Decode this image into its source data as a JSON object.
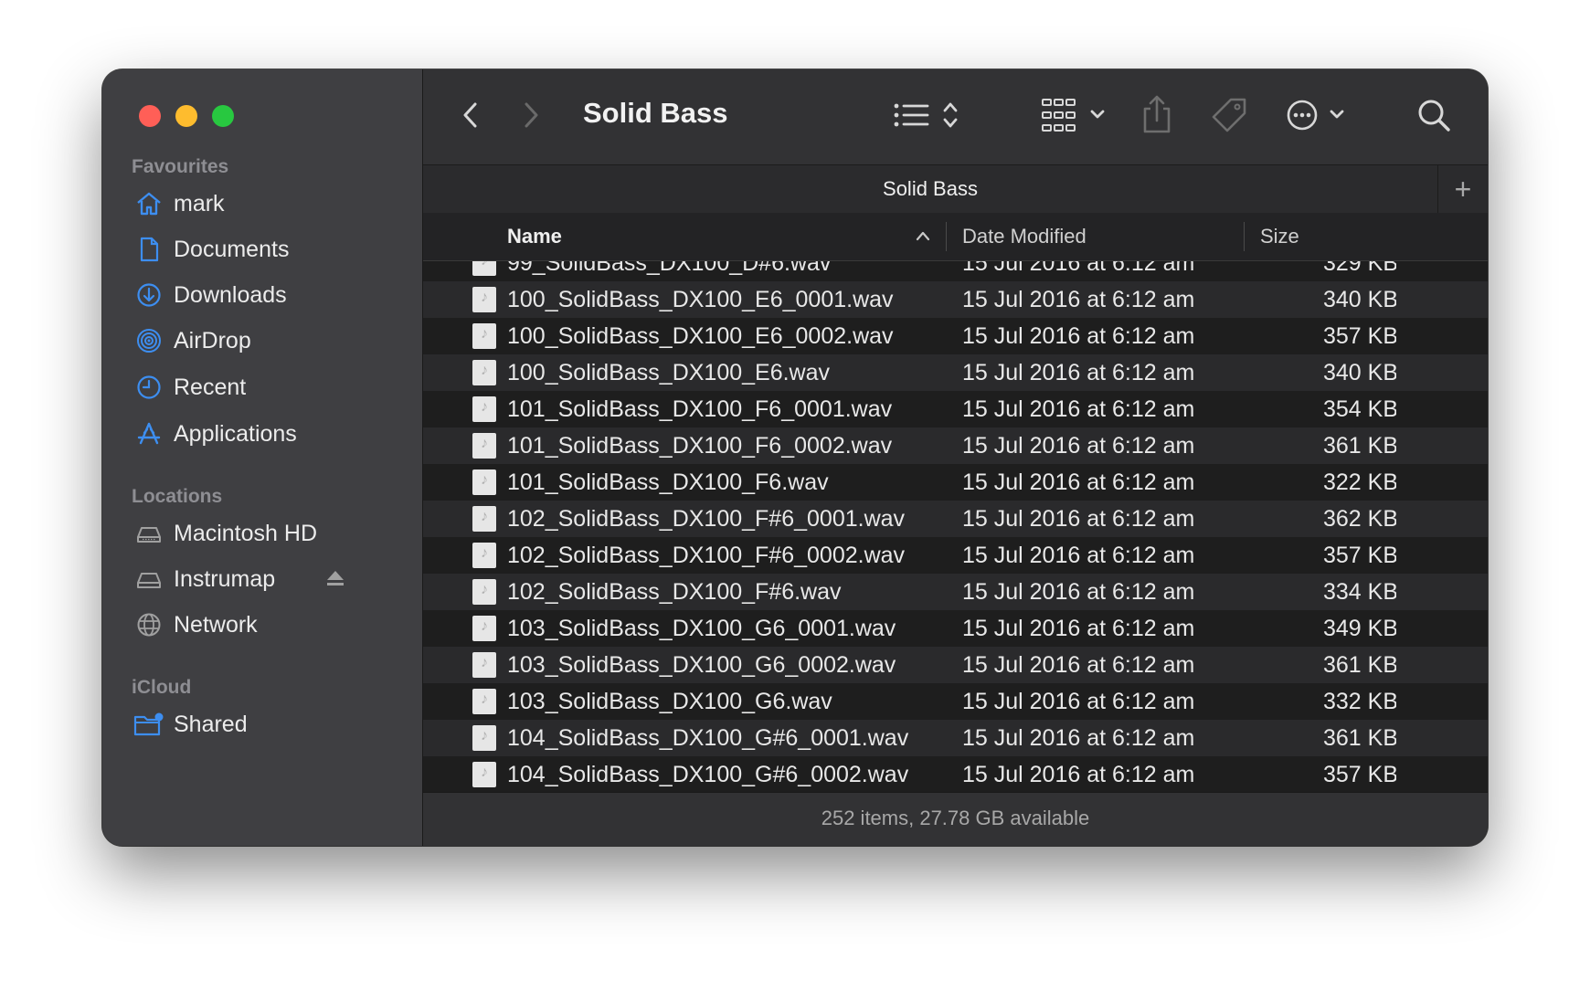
{
  "window": {
    "title": "Solid Bass"
  },
  "sidebar": {
    "favourites_label": "Favourites",
    "favourites": [
      {
        "label": "mark",
        "icon": "home-icon"
      },
      {
        "label": "Documents",
        "icon": "document-icon"
      },
      {
        "label": "Downloads",
        "icon": "download-icon"
      },
      {
        "label": "AirDrop",
        "icon": "airdrop-icon"
      },
      {
        "label": "Recent",
        "icon": "clock-icon"
      },
      {
        "label": "Applications",
        "icon": "applications-icon"
      }
    ],
    "locations_label": "Locations",
    "locations": [
      {
        "label": "Macintosh HD",
        "icon": "drive-icon"
      },
      {
        "label": "Instrumap",
        "icon": "drive-icon"
      },
      {
        "label": "Network",
        "icon": "globe-icon"
      }
    ],
    "icloud_label": "iCloud",
    "icloud": [
      {
        "label": "Shared",
        "icon": "shared-folder-icon"
      }
    ]
  },
  "tab": {
    "title": "Solid Bass",
    "add": "+"
  },
  "columns": {
    "name": "Name",
    "date": "Date Modified",
    "size": "Size"
  },
  "files": [
    {
      "name": "99_SolidBass_DX100_D#6.wav",
      "date": "15 Jul 2016 at 6:12 am",
      "size": "329 KB"
    },
    {
      "name": "100_SolidBass_DX100_E6_0001.wav",
      "date": "15 Jul 2016 at 6:12 am",
      "size": "340 KB"
    },
    {
      "name": "100_SolidBass_DX100_E6_0002.wav",
      "date": "15 Jul 2016 at 6:12 am",
      "size": "357 KB"
    },
    {
      "name": "100_SolidBass_DX100_E6.wav",
      "date": "15 Jul 2016 at 6:12 am",
      "size": "340 KB"
    },
    {
      "name": "101_SolidBass_DX100_F6_0001.wav",
      "date": "15 Jul 2016 at 6:12 am",
      "size": "354 KB"
    },
    {
      "name": "101_SolidBass_DX100_F6_0002.wav",
      "date": "15 Jul 2016 at 6:12 am",
      "size": "361 KB"
    },
    {
      "name": "101_SolidBass_DX100_F6.wav",
      "date": "15 Jul 2016 at 6:12 am",
      "size": "322 KB"
    },
    {
      "name": "102_SolidBass_DX100_F#6_0001.wav",
      "date": "15 Jul 2016 at 6:12 am",
      "size": "362 KB"
    },
    {
      "name": "102_SolidBass_DX100_F#6_0002.wav",
      "date": "15 Jul 2016 at 6:12 am",
      "size": "357 KB"
    },
    {
      "name": "102_SolidBass_DX100_F#6.wav",
      "date": "15 Jul 2016 at 6:12 am",
      "size": "334 KB"
    },
    {
      "name": "103_SolidBass_DX100_G6_0001.wav",
      "date": "15 Jul 2016 at 6:12 am",
      "size": "349 KB"
    },
    {
      "name": "103_SolidBass_DX100_G6_0002.wav",
      "date": "15 Jul 2016 at 6:12 am",
      "size": "361 KB"
    },
    {
      "name": "103_SolidBass_DX100_G6.wav",
      "date": "15 Jul 2016 at 6:12 am",
      "size": "332 KB"
    },
    {
      "name": "104_SolidBass_DX100_G#6_0001.wav",
      "date": "15 Jul 2016 at 6:12 am",
      "size": "361 KB"
    },
    {
      "name": "104_SolidBass_DX100_G#6_0002.wav",
      "date": "15 Jul 2016 at 6:12 am",
      "size": "357 KB"
    }
  ],
  "status": "252 items, 27.78 GB available",
  "colors": {
    "accent": "#3d8ef0",
    "close": "#ff5f57",
    "minimize": "#febc2e",
    "zoom": "#28c840"
  }
}
